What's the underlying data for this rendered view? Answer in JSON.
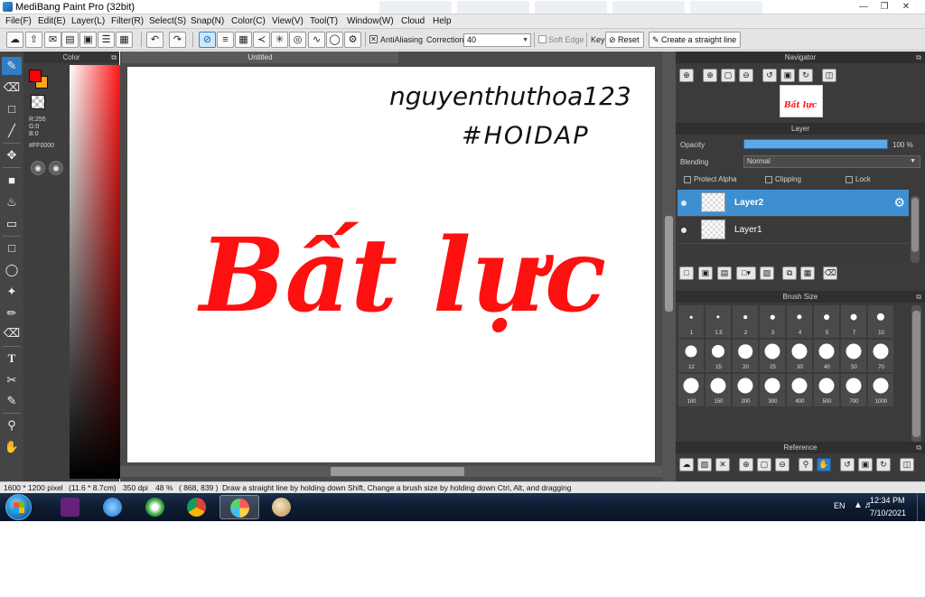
{
  "window": {
    "title": "MediBang Paint Pro (32bit)",
    "minimize_icon": "minimize-icon",
    "maximize_icon": "maximize-icon",
    "close_icon": "close-icon"
  },
  "menu": [
    "File(F)",
    "Edit(E)",
    "Layer(L)",
    "Filter(R)",
    "Select(S)",
    "Snap(N)",
    "Color(C)",
    "View(V)",
    "Tool(T)",
    "Window(W)",
    "Cloud",
    "Help"
  ],
  "toolbar": {
    "antialiasing_label": "AntiAliasing",
    "antialiasing_checked": true,
    "correction_label": "Correction",
    "correction_value": "40",
    "soft_edge_label": "Soft Edge",
    "soft_edge_checked": false,
    "key_label": "Key",
    "reset_label": "Reset",
    "straight_line_label": "Create a straight line"
  },
  "color_panel": {
    "title": "Color",
    "primary": "#FF0000",
    "secondary": "#F5A623",
    "r": "R:255",
    "g": "G:0",
    "b": "B:0",
    "hex": "#FF0000"
  },
  "canvas": {
    "tab_title": "Untitled",
    "signature_line1": "nguyenthuthoa123",
    "signature_line2": "#HOIDAP",
    "artwork_text": "Bất lực",
    "artwork_color": "#FF1010",
    "ink_color": "#111111"
  },
  "navigator": {
    "title": "Navigator"
  },
  "layer_panel": {
    "title": "Layer",
    "opacity_label": "Opacity",
    "opacity_value": "100 %",
    "opacity_level": 1.0,
    "blending_label": "Blending",
    "blending_value": "Normal",
    "protect_alpha_label": "Protect Alpha",
    "clipping_label": "Clipping",
    "lock_label": "Lock",
    "layers": [
      {
        "name": "Layer2",
        "selected": true
      },
      {
        "name": "Layer1",
        "selected": false
      }
    ]
  },
  "brush_size_panel": {
    "title": "Brush Size",
    "sizes": [
      "1",
      "1.5",
      "2",
      "3",
      "4",
      "5",
      "7",
      "10",
      "12",
      "15",
      "20",
      "25",
      "30",
      "40",
      "50",
      "70",
      "100",
      "150",
      "200",
      "300",
      "400",
      "500",
      "700",
      "1000"
    ]
  },
  "reference_panel": {
    "title": "Reference"
  },
  "status_bar": {
    "size": "1600 * 1200 pixel",
    "physical": "(11.6 * 8.7cm)",
    "dpi": "350 dpi",
    "zoom": "48 %",
    "coords": "( 868, 839 )",
    "hint": "Draw a straight line by holding down Shift, Change a brush size by holding down Ctrl, Alt, and dragging"
  },
  "taskbar": {
    "apps": [
      "visual-studio-icon",
      "internet-explorer-icon",
      "coccoc-browser-icon",
      "chrome-icon",
      "medibang-icon",
      "paint-palette-icon"
    ],
    "language": "EN",
    "time": "12:34 PM",
    "date": "7/10/2021"
  }
}
